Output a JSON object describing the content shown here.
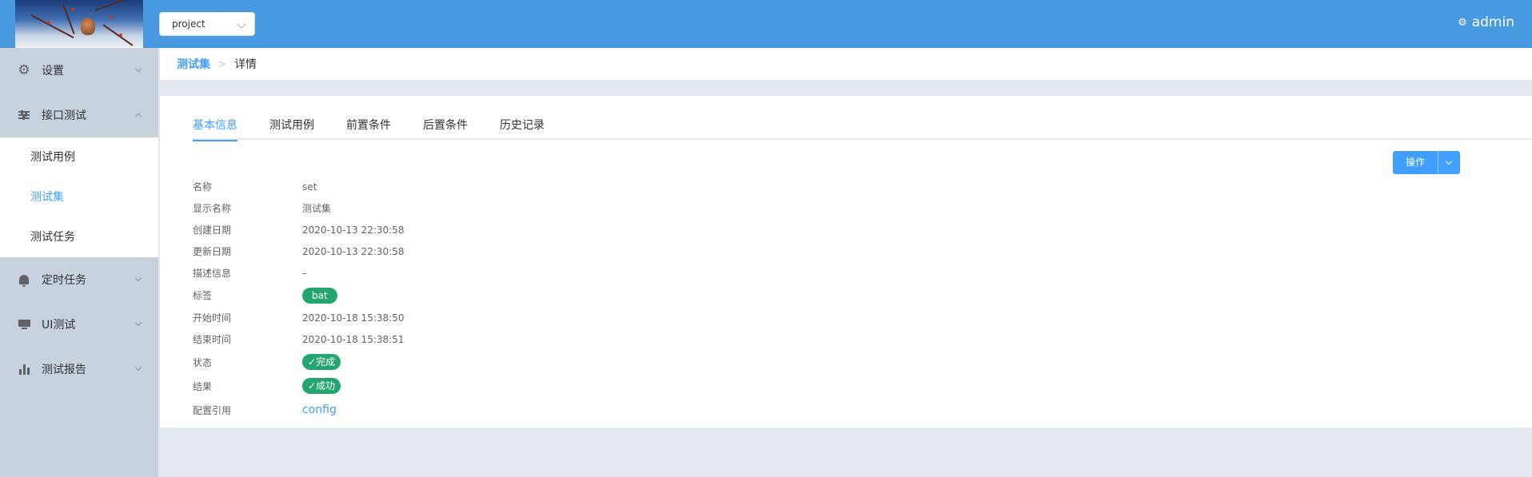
{
  "header": {
    "project_select": "project",
    "user": "admin",
    "user_icon": "gear-icon"
  },
  "sidebar": {
    "groups": [
      {
        "label": "设置",
        "icon": "gear-icon",
        "expanded": false
      },
      {
        "label": "接口测试",
        "icon": "sliders-icon",
        "expanded": true,
        "children": [
          {
            "label": "测试用例",
            "active": false
          },
          {
            "label": "测试集",
            "active": true
          },
          {
            "label": "测试任务",
            "active": false
          }
        ]
      },
      {
        "label": "定时任务",
        "icon": "bell-icon",
        "expanded": false
      },
      {
        "label": "UI测试",
        "icon": "monitor-icon",
        "expanded": false
      },
      {
        "label": "测试报告",
        "icon": "bar-chart-icon",
        "expanded": false
      }
    ]
  },
  "breadcrumb": {
    "parent": "测试集",
    "separator": ">",
    "current": "详情"
  },
  "tabs": [
    "基本信息",
    "测试用例",
    "前置条件",
    "后置条件",
    "历史记录"
  ],
  "active_tab": "基本信息",
  "actions": {
    "operate_label": "操作"
  },
  "detail": {
    "name": {
      "label": "名称",
      "value": "set"
    },
    "display_name": {
      "label": "显示名称",
      "value": "测试集"
    },
    "created": {
      "label": "创建日期",
      "value": "2020-10-13 22:30:58"
    },
    "updated": {
      "label": "更新日期",
      "value": "2020-10-13 22:30:58"
    },
    "description": {
      "label": "描述信息",
      "value": "–"
    },
    "tags": {
      "label": "标签",
      "value": "bat"
    },
    "start_time": {
      "label": "开始时间",
      "value": "2020-10-18 15:38:50"
    },
    "end_time": {
      "label": "结束时间",
      "value": "2020-10-18 15:38:51"
    },
    "status": {
      "label": "状态",
      "value": "完成"
    },
    "result": {
      "label": "结果",
      "value": "成功"
    },
    "config_ref": {
      "label": "配置引用",
      "value": "config"
    }
  },
  "colors": {
    "header_bg": "#4799e0",
    "accent": "#409eff",
    "success": "#22a56f",
    "sidebar_bg": "#c8d2df"
  }
}
